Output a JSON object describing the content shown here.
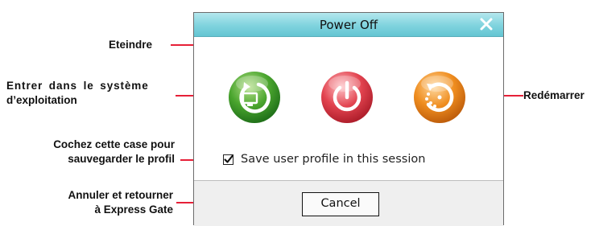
{
  "dialog": {
    "title": "Power Off",
    "checkbox": {
      "label": "Save user profile in this session",
      "checked": true
    },
    "cancel_label": "Cancel",
    "buttons": [
      {
        "name": "enter-os",
        "color": "#4aa52e",
        "icon": "monitor-refresh-icon"
      },
      {
        "name": "power-off",
        "color": "#e2434f",
        "icon": "power-icon"
      },
      {
        "name": "restart",
        "color": "#ef8d1f",
        "icon": "restart-icon"
      }
    ]
  },
  "callouts": {
    "eteindre": "Eteindre",
    "entrer_line1": "Entrer dans le système",
    "entrer_line2": "d’exploitation",
    "redemarrer": "Redémarrer",
    "cochez_line1": "Cochez cette case pour",
    "cochez_line2": "sauvegarder le profil",
    "annuler_line1": "Annuler et retourner",
    "annuler_line2": "à Express Gate"
  },
  "colors": {
    "callout_line": "#e3001b",
    "titlebar": "#7fd3de"
  }
}
